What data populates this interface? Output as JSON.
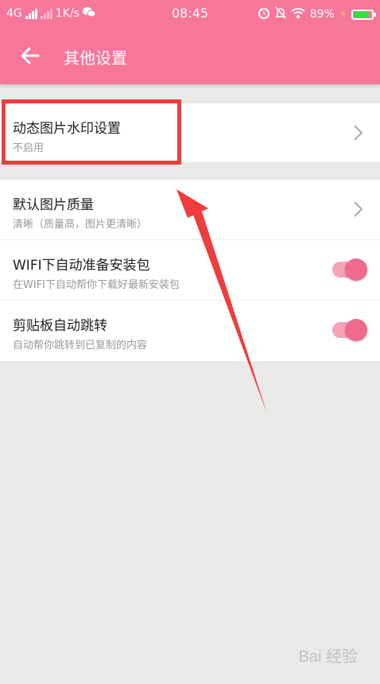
{
  "status_bar": {
    "network": "4G",
    "speed": "1K/s",
    "time": "08:45",
    "battery": "89%"
  },
  "app_bar": {
    "title": "其他设置"
  },
  "settings": {
    "watermark": {
      "title": "动态图片水印设置",
      "subtitle": "不启用"
    },
    "quality": {
      "title": "默认图片质量",
      "subtitle": "清晰（质量高，图片更清晰）"
    },
    "wifi_download": {
      "title": "WIFI下自动准备安装包",
      "subtitle": "在WIFI下自动帮你下载好最新安装包",
      "enabled": true
    },
    "clipboard_jump": {
      "title": "剪贴板自动跳转",
      "subtitle": "自动帮你跳转到已复制的内容",
      "enabled": true
    }
  },
  "watermark_text": "Bai 经验",
  "colors": {
    "accent": "#f7779a",
    "toggle_on": "#f06a8e",
    "annotation": "#ee3d3d"
  }
}
